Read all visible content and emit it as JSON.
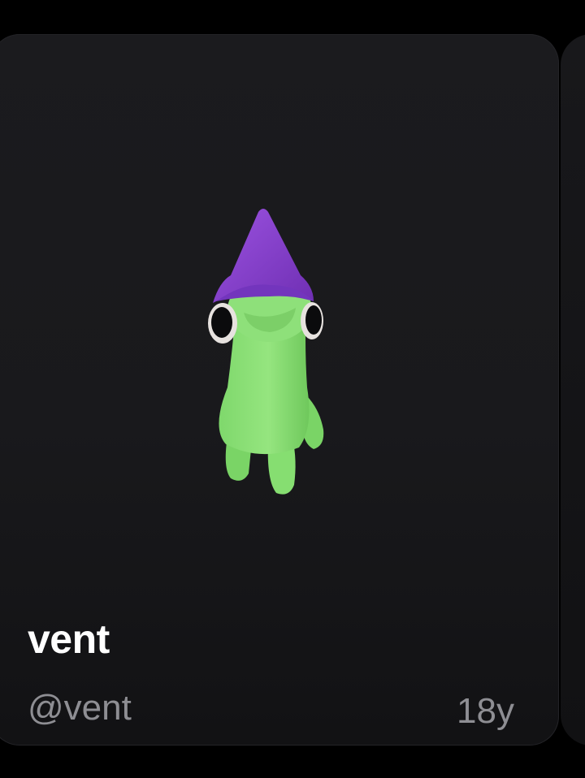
{
  "profile_card": {
    "display_name": "vent",
    "handle": "@vent",
    "age": "18y",
    "avatar_icon": "green-frog-wizard-hat-avatar"
  },
  "colors": {
    "background": "#000000",
    "card": "#1b1b1e",
    "name_text": "#ffffff",
    "secondary_text": "#8e8e93",
    "avatar_body": "#8ee07a",
    "avatar_hat": "#8a3fd0"
  }
}
